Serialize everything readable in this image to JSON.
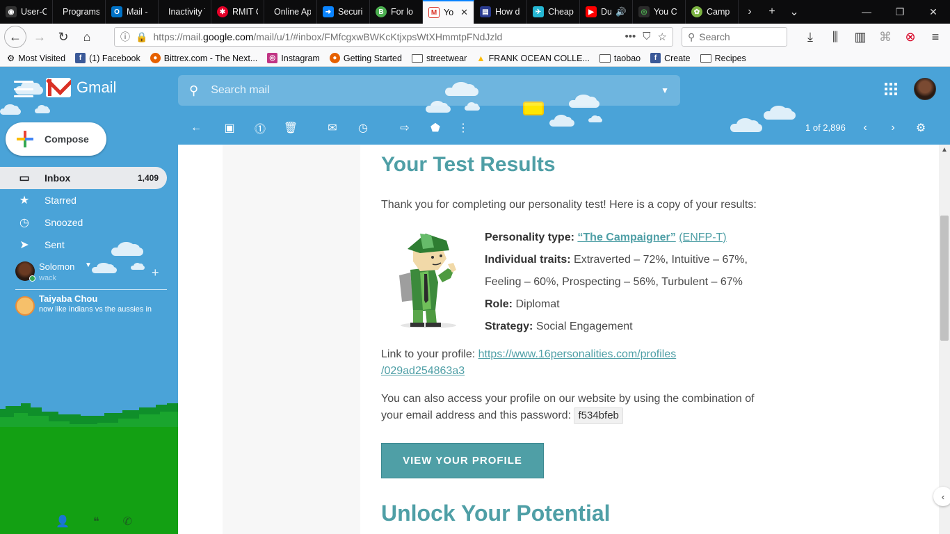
{
  "browser": {
    "tabs": [
      {
        "title": "User-C",
        "icon_color": "#1a1a1a"
      },
      {
        "title": "Programs",
        "icon_color": "#0c0c0d"
      },
      {
        "title": "Mail -",
        "icon_color": "#0072c6"
      },
      {
        "title": "Inactivity T",
        "icon_color": "#0c0c0d"
      },
      {
        "title": "RMIT C",
        "icon_color": "#e60028"
      },
      {
        "title": "Online Ap",
        "icon_color": "#0c0c0d"
      },
      {
        "title": "Securi",
        "icon_color": "#0a84ff"
      },
      {
        "title": "For lo",
        "icon_color": "#4caf50"
      },
      {
        "title": "Yo",
        "icon_color": "#d93025"
      },
      {
        "title": "How d",
        "icon_color": "#2a3b8f"
      },
      {
        "title": "Cheap",
        "icon_color": "#25b7d3"
      },
      {
        "title": "Du",
        "icon_color": "#ff0000"
      },
      {
        "title": "You C",
        "icon_color": "#4caf50"
      },
      {
        "title": "Camp",
        "icon_color": "#7cb342"
      }
    ],
    "url_prefix": "https://mail.",
    "url_host": "google.com",
    "url_path": "/mail/u/1/#inbox/FMfcgxwBWKcKtjxpsWtXHmmtpFNdJzld",
    "search_placeholder": "Search",
    "bookmarks": [
      {
        "label": "Most Visited",
        "icon": "gear-icon"
      },
      {
        "label": "(1) Facebook",
        "icon": "facebook-icon",
        "color": "#3b5998"
      },
      {
        "label": "Bittrex.com - The Next...",
        "icon": "firefox-icon",
        "color": "#e66000"
      },
      {
        "label": "Instagram",
        "icon": "instagram-icon",
        "color": "#c13584"
      },
      {
        "label": "Getting Started",
        "icon": "firefox-icon",
        "color": "#e66000"
      },
      {
        "label": "streetwear",
        "icon": "folder-icon"
      },
      {
        "label": "FRANK OCEAN COLLE...",
        "icon": "drive-icon",
        "color": "#fbbc04"
      },
      {
        "label": "taobao",
        "icon": "folder-icon"
      },
      {
        "label": "Create",
        "icon": "facebook-icon",
        "color": "#3b5998"
      },
      {
        "label": "Recipes",
        "icon": "folder-icon"
      }
    ]
  },
  "gmail": {
    "logo_text": "Gmail",
    "search_placeholder": "Search mail",
    "compose_label": "Compose",
    "nav": [
      {
        "label": "Inbox",
        "count": "1,409",
        "icon": "inbox-icon",
        "selected": true
      },
      {
        "label": "Starred",
        "count": "",
        "icon": "star-icon",
        "selected": false
      },
      {
        "label": "Snoozed",
        "count": "",
        "icon": "clock-icon",
        "selected": false
      },
      {
        "label": "Sent",
        "count": "",
        "icon": "send-icon",
        "selected": false
      }
    ],
    "hangouts": {
      "me_name": "Solomon",
      "me_status": "wack",
      "contact_name": "Taiyaba Chou",
      "contact_message": "now like indians vs the aussies in"
    },
    "pager": "1 of 2,896"
  },
  "email": {
    "title": "Your Test Results",
    "intro": "Thank you for completing our personality test! Here is a copy of your results:",
    "personality_label": "Personality type:",
    "personality_link": "“The Campaigner”",
    "personality_code": "(ENFP-T)",
    "traits_label": "Individual traits:",
    "traits_line1": "Extraverted – 72%, Intuitive – 67%,",
    "traits_line2": "Feeling – 60%, Prospecting – 56%, Turbulent – 67%",
    "role_label": "Role:",
    "role_value": "Diplomat",
    "strategy_label": "Strategy:",
    "strategy_value": "Social Engagement",
    "profile_link_label": "Link to your profile:",
    "profile_link_line1": "https://www.16personalities.com/profiles",
    "profile_link_line2": "/029ad254863a3",
    "access_text": "You can also access your profile on our website by using the combination of your email address and this password:",
    "password": "f534bfeb",
    "button_label": "VIEW YOUR PROFILE",
    "unlock_title": "Unlock Your Potential"
  },
  "colors": {
    "gmail_bg": "#4aa3d8",
    "accent_teal": "#4f9fa6",
    "selected_nav": "#e8eaed",
    "grass": "#13a013"
  }
}
